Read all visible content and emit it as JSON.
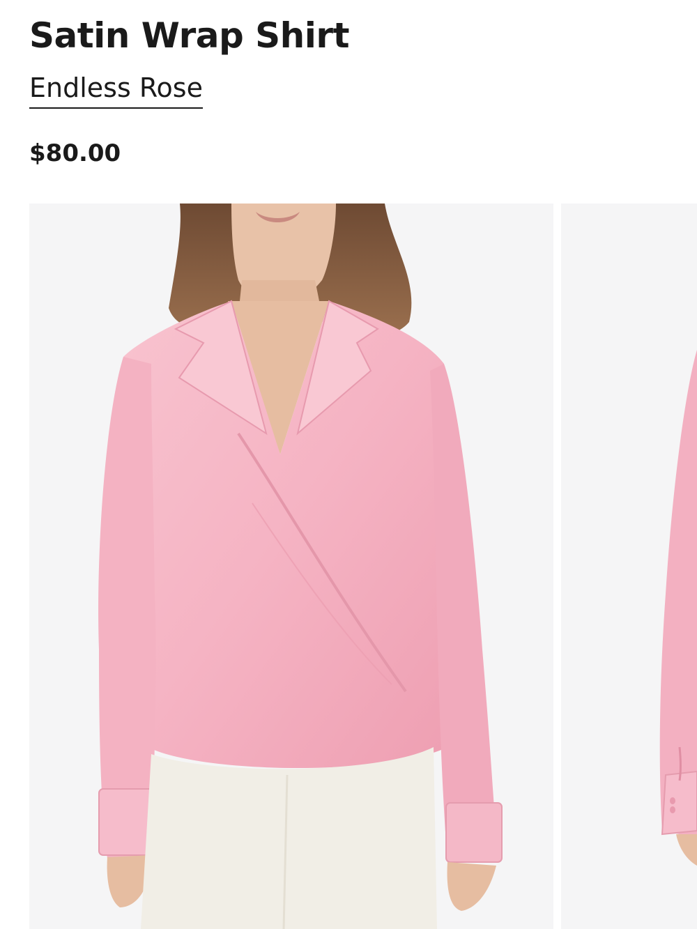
{
  "product": {
    "title": "Satin Wrap Shirt",
    "brand": "Endless Rose",
    "price": "$80.00"
  },
  "gallery": {
    "images": [
      {
        "name": "product-image-front",
        "alt": "Model wearing pink satin wrap shirt with white shorts, front view"
      },
      {
        "name": "product-image-side",
        "alt": "Pink satin wrap shirt, side view"
      }
    ]
  },
  "colors": {
    "background": "#ffffff",
    "image_background": "#f5f5f6",
    "shirt_pink": "#f6b8c6",
    "text": "#1a1a1a"
  }
}
